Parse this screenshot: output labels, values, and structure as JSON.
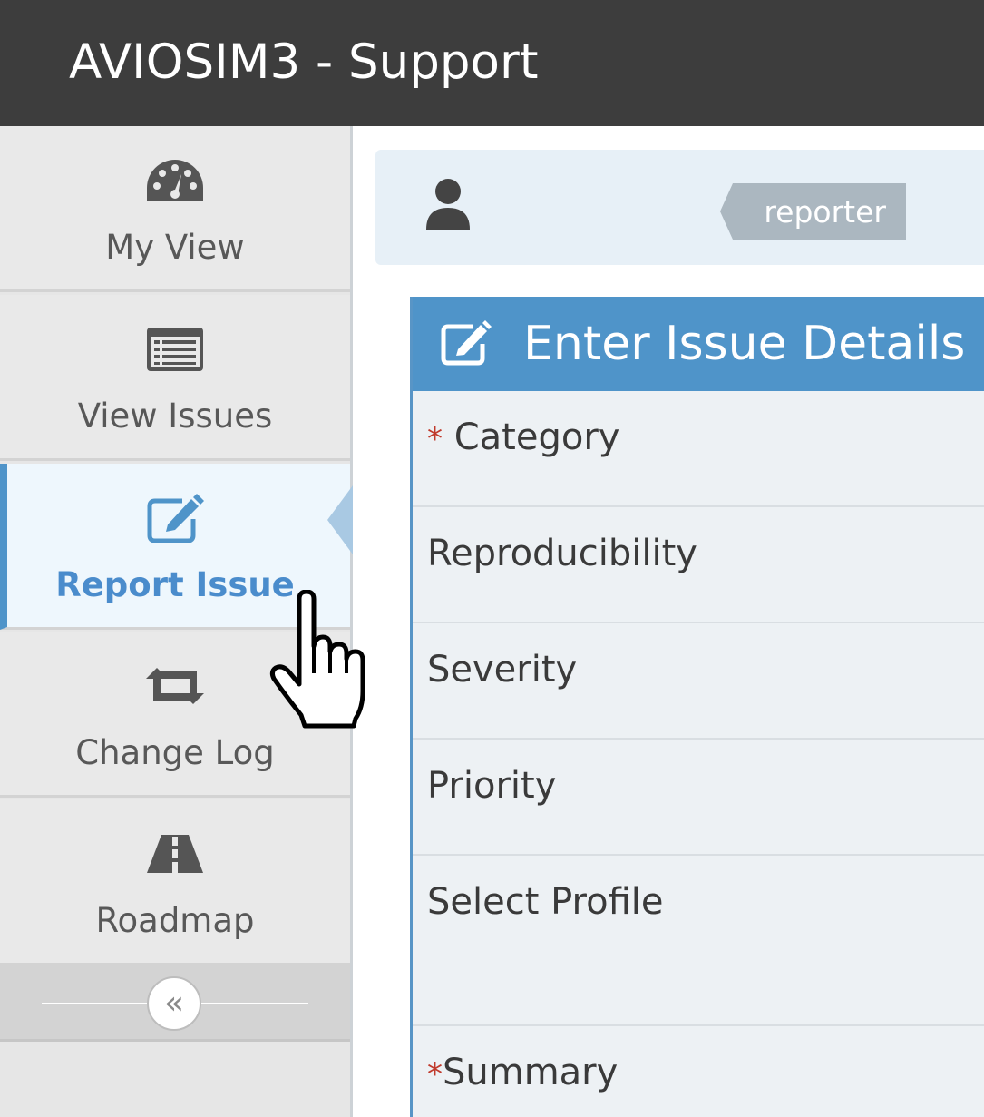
{
  "header": {
    "title": "AVIOSIM3 - Support"
  },
  "sidebar": {
    "items": [
      {
        "label": "My View",
        "icon": "dashboard-icon"
      },
      {
        "label": "View Issues",
        "icon": "list-icon"
      },
      {
        "label": "Report Issue",
        "icon": "edit-icon",
        "active": true
      },
      {
        "label": "Change Log",
        "icon": "retweet-icon"
      },
      {
        "label": "Roadmap",
        "icon": "road-icon"
      }
    ],
    "collapse": {
      "glyph": "«",
      "icon": "double-angle-left-icon"
    }
  },
  "user_bar": {
    "role": "reporter",
    "icon": "user-icon"
  },
  "form": {
    "title": "Enter Issue Details",
    "icon": "edit-icon",
    "required_mark": "*",
    "fields": [
      {
        "label": "Category",
        "required": true
      },
      {
        "label": "Reproducibility",
        "required": false
      },
      {
        "label": "Severity",
        "required": false
      },
      {
        "label": "Priority",
        "required": false
      },
      {
        "label": "Select Profile",
        "required": false
      },
      {
        "label": "Summary",
        "required": true
      }
    ]
  },
  "colors": {
    "topbar": "#3d3d3d",
    "accent": "#4f94c9",
    "required": "#c0392b",
    "tag": "#abb7c0"
  }
}
